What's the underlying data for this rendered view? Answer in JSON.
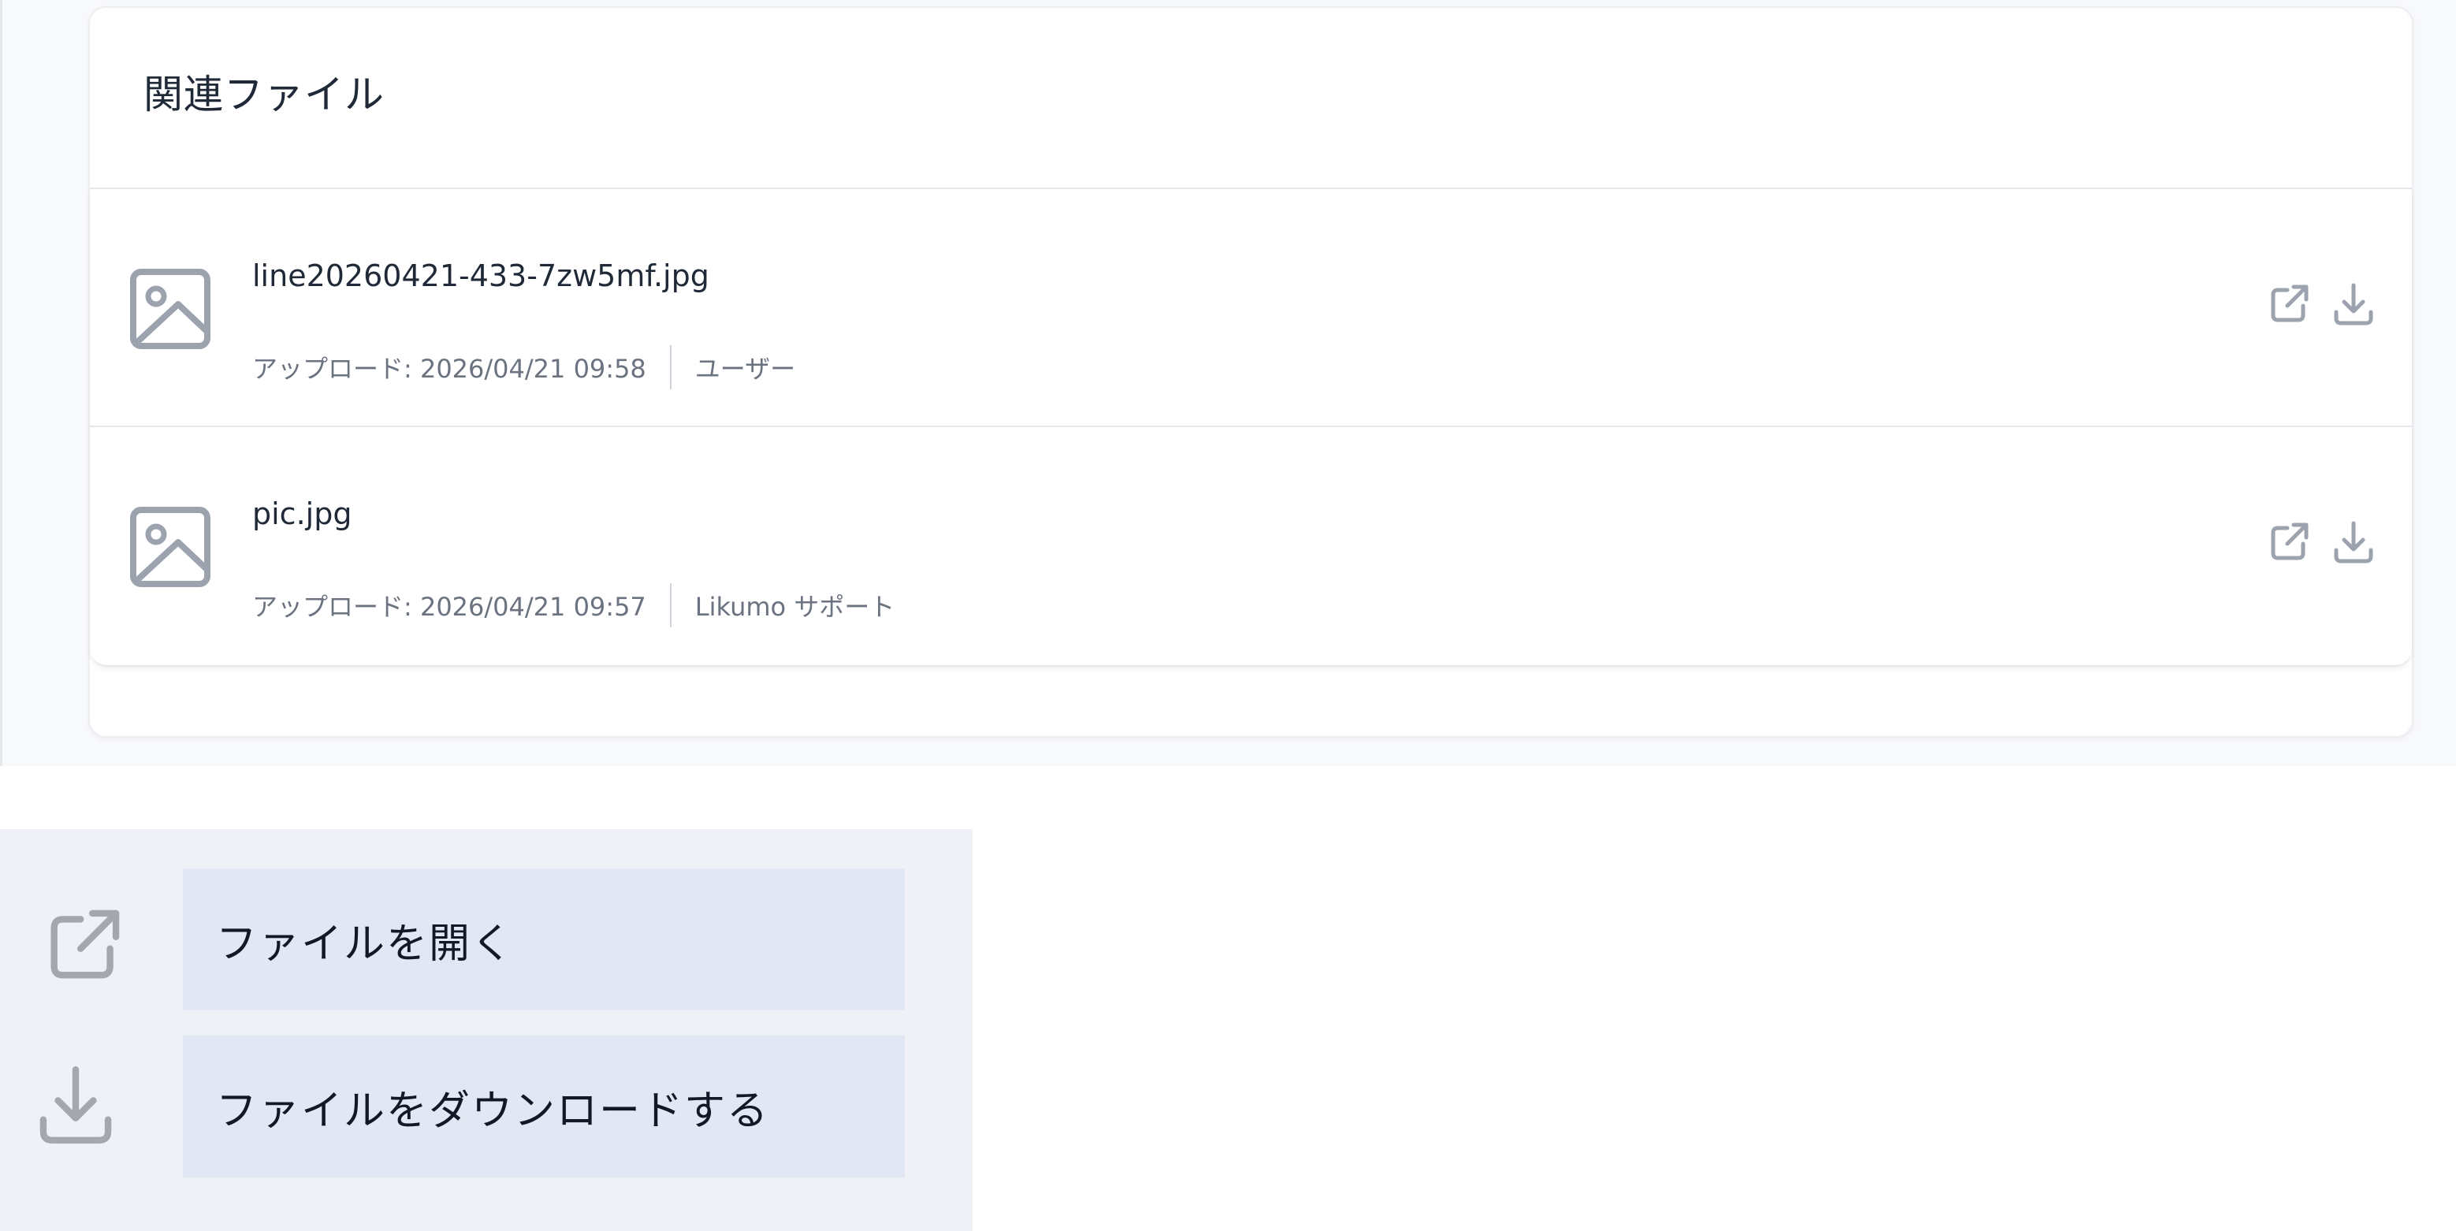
{
  "panel": {
    "title": "関連ファイル"
  },
  "files": [
    {
      "name": "line20260421-433-7zw5mf.jpg",
      "upload_label": "アップロード: 2026/04/21 09:58",
      "uploader": "ユーザー",
      "icon": "image-file-icon"
    },
    {
      "name": "pic.jpg",
      "upload_label": "アップロード: 2026/04/21 09:57",
      "uploader": "Likumo サポート",
      "icon": "image-file-icon"
    }
  ],
  "legend": {
    "open_label": "ファイルを開く",
    "download_label": "ファイルをダウンロードする"
  },
  "colors": {
    "icon": "#9ca3af",
    "legend_background": "#eff1f6",
    "legend_label_background": "#e2e8f3"
  }
}
